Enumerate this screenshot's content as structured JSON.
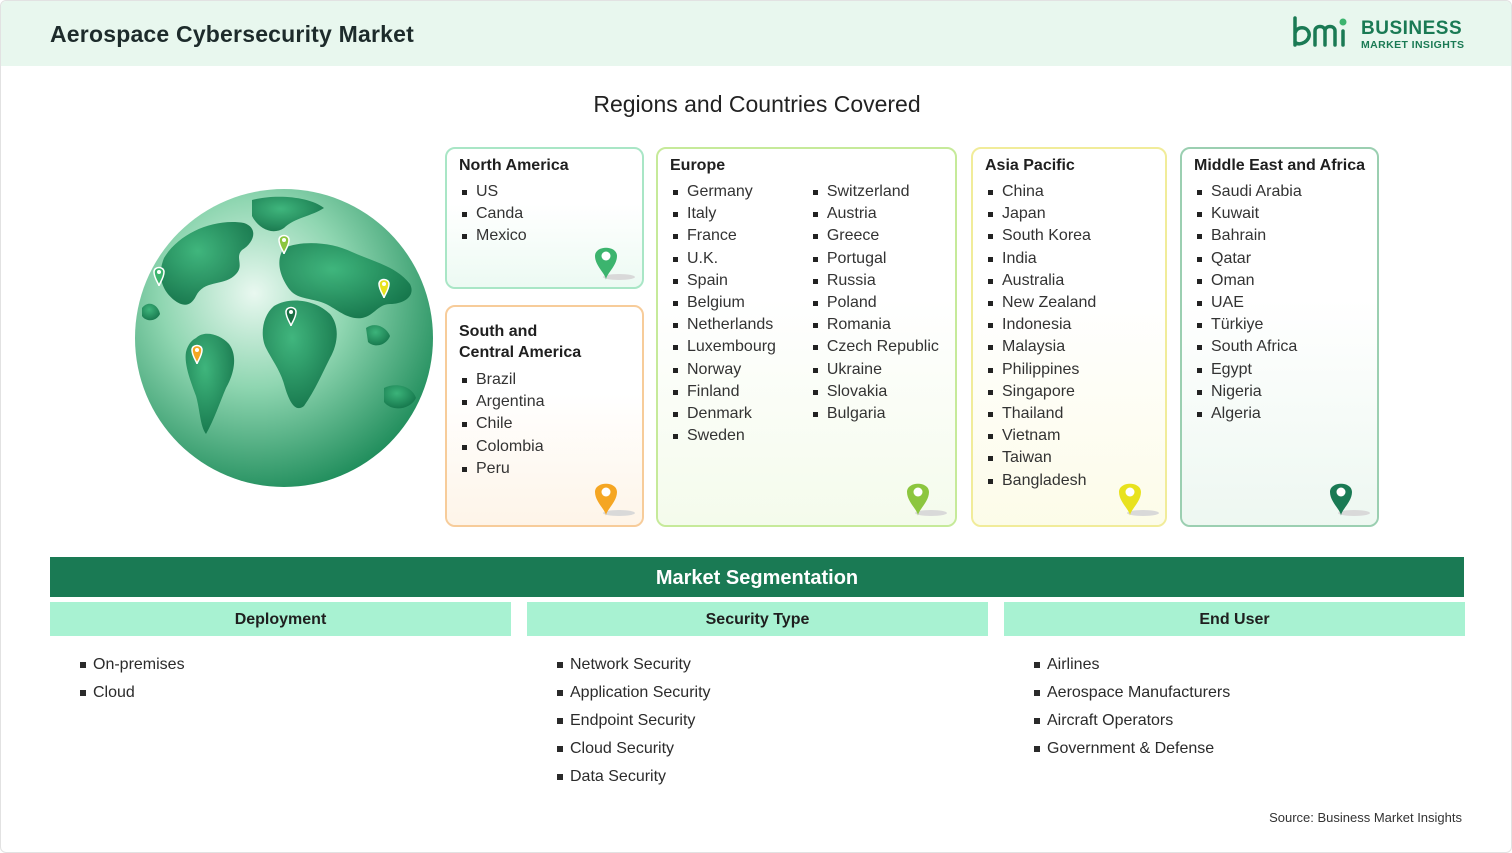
{
  "header": {
    "title": "Aerospace Cybersecurity Market",
    "logo": {
      "word1": "BUSINESS",
      "word2": "MARKET INSIGHTS",
      "icon": "bmi-logo-icon",
      "color": "#1a7a54"
    }
  },
  "regions_section": {
    "title": "Regions and Countries Covered",
    "regions": [
      {
        "name": "North America",
        "pin_color": "#3cb46e",
        "border_color": "#a9e6c6",
        "countries": [
          "US",
          "Canda",
          "Mexico"
        ]
      },
      {
        "name": "South and Central America",
        "name_line1": "South and",
        "name_line2": "Central America",
        "pin_color": "#f5a623",
        "border_color": "#f7cc9a",
        "countries": [
          "Brazil",
          "Argentina",
          "Chile",
          "Colombia",
          "Peru"
        ]
      },
      {
        "name": "Europe",
        "pin_color": "#8cc63f",
        "border_color": "#c6ea9a",
        "countries_col1": [
          "Germany",
          "Italy",
          "France",
          "U.K.",
          "Spain",
          "Belgium",
          "Netherlands",
          "Luxembourg",
          "Norway",
          "Finland",
          "Denmark",
          "Sweden"
        ],
        "countries_col2": [
          "Switzerland",
          "Austria",
          "Greece",
          "Portugal",
          "Russia",
          "Poland",
          "Romania",
          "Czech Republic",
          "Ukraine",
          "Slovakia",
          "Bulgaria"
        ]
      },
      {
        "name": "Asia Pacific",
        "pin_color": "#e8e21e",
        "border_color": "#f1ec9a",
        "countries": [
          "China",
          "Japan",
          "South Korea",
          "India",
          "Australia",
          "New Zealand",
          "Indonesia",
          "Malaysia",
          "Philippines",
          "Singapore",
          "Thailand",
          "Vietnam",
          "Taiwan",
          "Bangladesh"
        ]
      },
      {
        "name": "Middle East and Africa",
        "pin_color": "#1a7a54",
        "border_color": "#9bcfb1",
        "countries": [
          "Saudi Arabia",
          "Kuwait",
          "Bahrain",
          "Qatar",
          "Oman",
          "UAE",
          "Türkiye",
          "South Africa",
          "Egypt",
          "Nigeria",
          "Algeria"
        ]
      }
    ]
  },
  "segmentation": {
    "title": "Market Segmentation",
    "columns": [
      {
        "heading": "Deployment",
        "items": [
          "On-premises",
          "Cloud"
        ]
      },
      {
        "heading": "Security Type",
        "items": [
          "Network Security",
          "Application Security",
          "Endpoint Security",
          "Cloud Security",
          "Data Security"
        ]
      },
      {
        "heading": "End User",
        "items": [
          "Airlines",
          "Aerospace Manufacturers",
          "Aircraft Operators",
          "Government & Defense"
        ]
      }
    ],
    "banner_color": "#1a7a54",
    "heading_color": "#a8f2d2"
  },
  "source": "Source: Business Market Insights"
}
